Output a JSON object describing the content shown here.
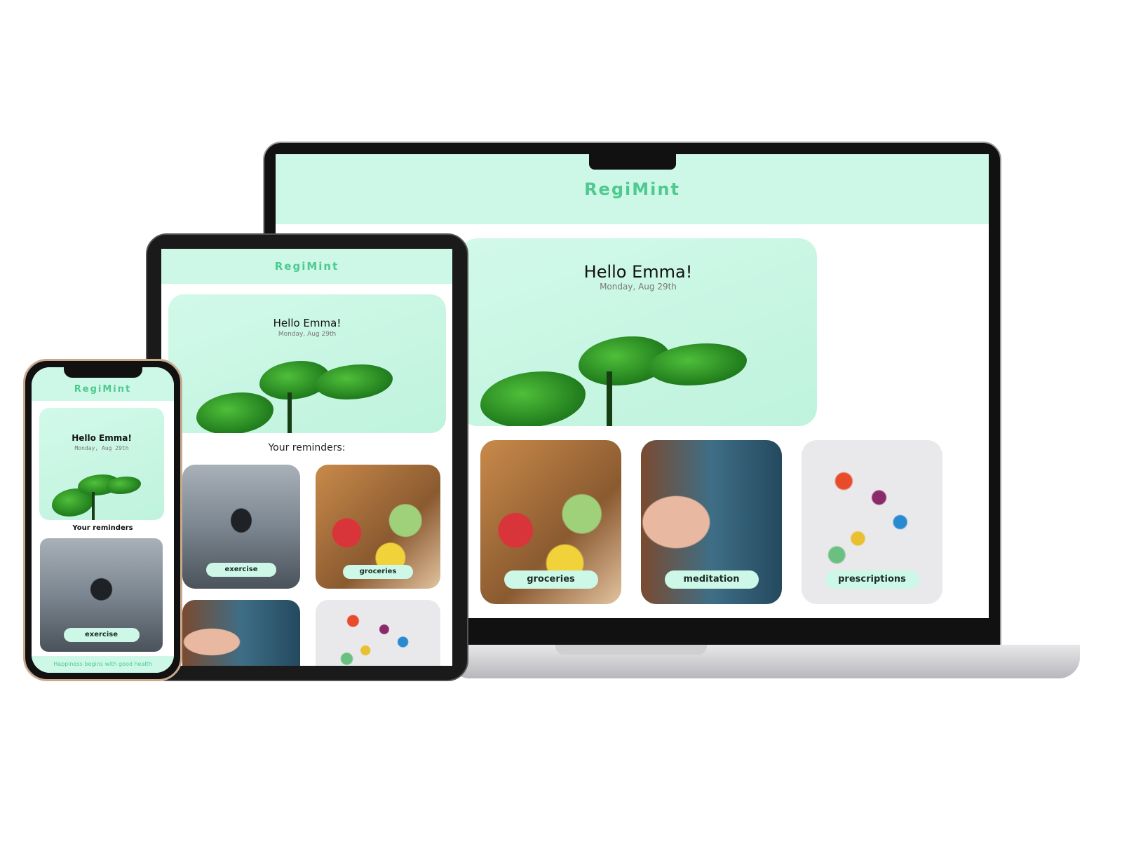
{
  "app": {
    "title": "RegiMint",
    "greeting": "Hello Emma!",
    "date": "Monday, Aug 29th"
  },
  "reminders_heading": {
    "tablet": "Your reminders:",
    "phone": "Your reminders"
  },
  "reminders": [
    {
      "label": "exercise"
    },
    {
      "label": "groceries"
    },
    {
      "label": "meditation"
    },
    {
      "label": "prescriptions"
    }
  ],
  "footer": "Happiness begins with good health",
  "colors": {
    "mint": "#cdf8e8",
    "brand": "#4fc98f"
  }
}
